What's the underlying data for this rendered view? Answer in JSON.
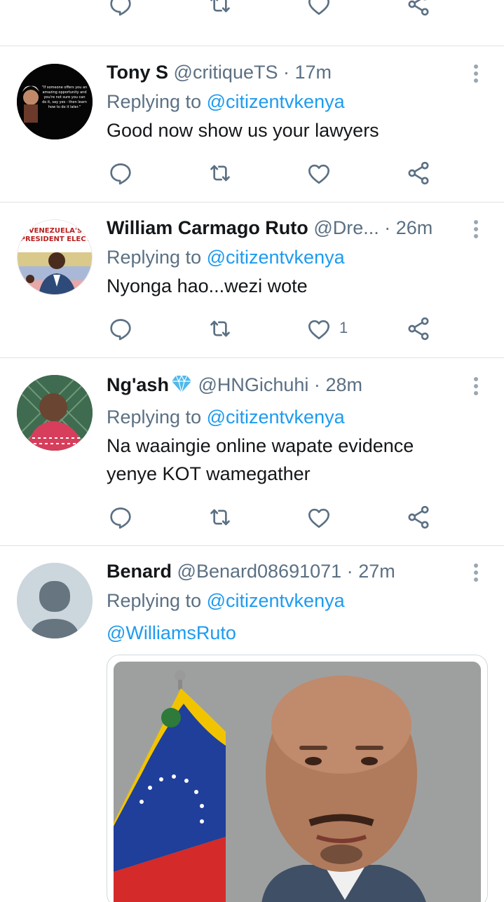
{
  "colors": {
    "accent": "#1d9bf0",
    "muted": "#5b7083",
    "text": "#14171a",
    "divider": "#dfe3e6"
  },
  "tweets": [
    {
      "name": "Tony S",
      "handle": "@critiqueTS",
      "time": "17m",
      "replying_label": "Replying to",
      "replying_to": "@citizentvkenya",
      "text": "Good now show us your lawyers",
      "like_count": ""
    },
    {
      "name": "William Carmago Ruto",
      "handle": "@Dre...",
      "time": "26m",
      "replying_label": "Replying to",
      "replying_to": "@citizentvkenya",
      "text": "Nyonga hao...wezi wote",
      "like_count": "1"
    },
    {
      "name": "Ng'ash",
      "handle": "@HNGichuhi",
      "time": "28m",
      "replying_label": "Replying to",
      "replying_to": "@citizentvkenya",
      "text_line1": "Na waaingie online wapate evidence",
      "text_line2": "yenye KOT wamegather",
      "like_count": ""
    },
    {
      "name": "Benard",
      "handle": "@Benard08691071",
      "time": "27m",
      "replying_label": "Replying to",
      "replying_to": "@citizentvkenya",
      "mention": "@WilliamsRuto"
    }
  ],
  "avatar_texts": {
    "quote_avatar": "\"If someone offers you an amazing opportunity and you're not sure you can do it, say yes - then learn how to do it later.\"",
    "banner_line1": "VENEZUELA'S",
    "banner_line2": "PRESIDENT ELECT"
  },
  "separator": "·"
}
